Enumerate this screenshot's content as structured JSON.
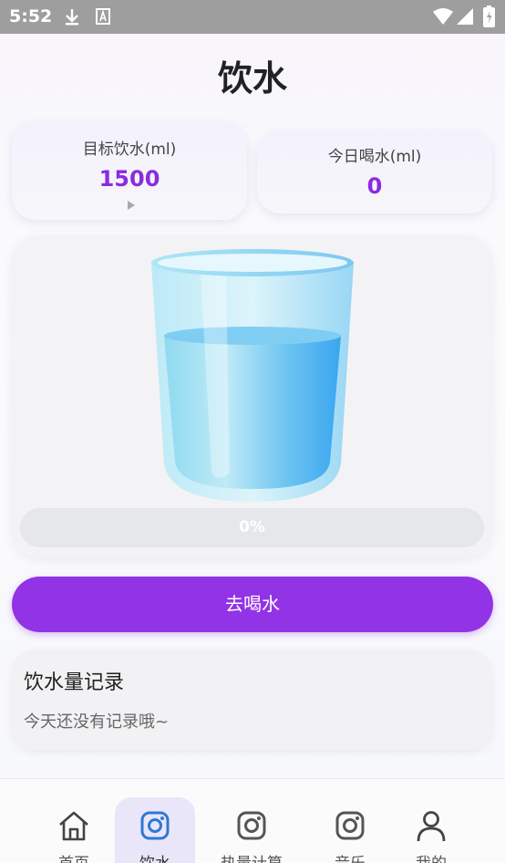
{
  "status_bar": {
    "time": "5:52"
  },
  "page": {
    "title": "饮水"
  },
  "goal_card": {
    "label": "目标饮水(ml)",
    "value": "1500"
  },
  "today_card": {
    "label": "今日喝水(ml)",
    "value": "0"
  },
  "glass": {
    "progress_text": "0%",
    "progress_fraction": 0
  },
  "actions": {
    "drink_label": "去喝水"
  },
  "records": {
    "title": "饮水量记录",
    "empty_text": "今天还没有记录哦~"
  },
  "nav": {
    "items": [
      {
        "label": "首页",
        "icon": "home-icon"
      },
      {
        "label": "饮水",
        "icon": "camera-icon",
        "active": true
      },
      {
        "label": "热量计算",
        "icon": "camera-icon"
      },
      {
        "label": "音乐",
        "icon": "camera-icon"
      },
      {
        "label": "我的",
        "icon": "person-icon"
      }
    ]
  },
  "colors": {
    "accent": "#9233e6",
    "value_purple": "#8b2be0",
    "nav_active": "#2f78d4"
  }
}
